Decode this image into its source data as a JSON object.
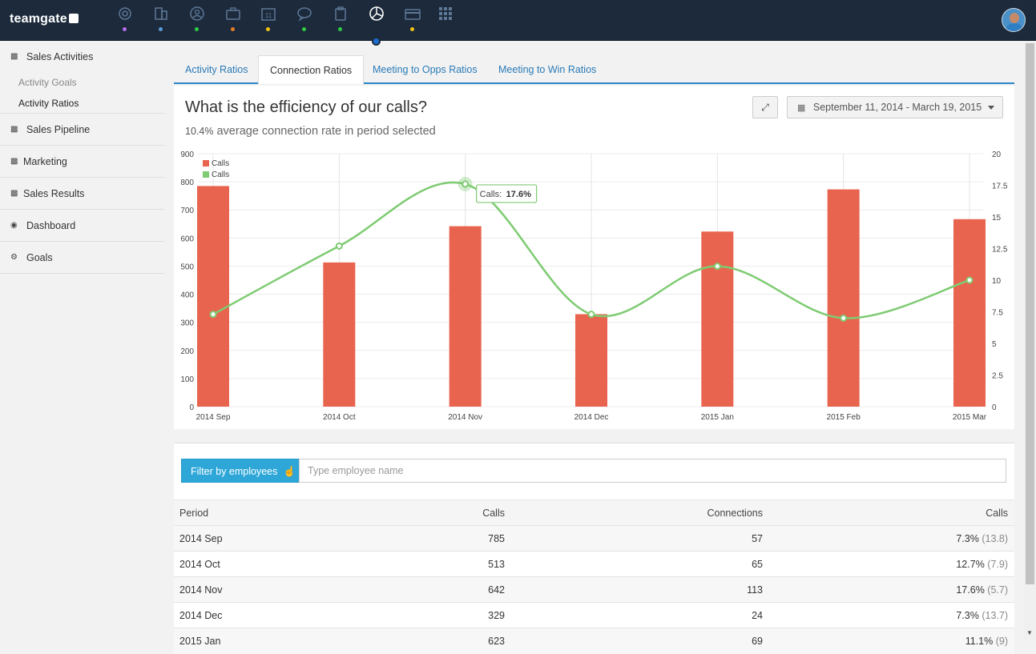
{
  "app": {
    "logo": "teamgate",
    "nav_icons": [
      {
        "name": "target-icon",
        "dot": "#b36ef0"
      },
      {
        "name": "building-icon",
        "dot": "#5b9bd5"
      },
      {
        "name": "person-icon",
        "dot": "#2ecc40"
      },
      {
        "name": "briefcase-icon",
        "dot": "#e67e22"
      },
      {
        "name": "calendar-icon",
        "dot": "#f1c40f",
        "label": "11"
      },
      {
        "name": "chat-icon",
        "dot": "#2ecc40"
      },
      {
        "name": "clipboard-icon",
        "dot": "#2ecc40"
      },
      {
        "name": "pie-chart-icon",
        "dot": null,
        "active": true
      },
      {
        "name": "credit-card-icon",
        "dot": "#f1c40f"
      },
      {
        "name": "grid-icon",
        "dot": null
      }
    ]
  },
  "sidebar": {
    "sections": [
      {
        "label": "Sales Activities",
        "icon": "bar-chart-icon",
        "items": [
          {
            "label": "Activity Goals",
            "active": false
          },
          {
            "label": "Activity Ratios",
            "active": true
          }
        ]
      },
      {
        "label": "Sales Pipeline",
        "icon": "bar-chart-icon"
      },
      {
        "label": "Marketing",
        "icon": "bar-chart-icon"
      },
      {
        "label": "Sales Results",
        "icon": "bar-chart-icon"
      },
      {
        "label": "Dashboard",
        "icon": "dashboard-icon"
      },
      {
        "label": "Goals",
        "icon": "gears-icon"
      }
    ]
  },
  "tabs": [
    {
      "label": "Activity Ratios",
      "active": false
    },
    {
      "label": "Connection Ratios",
      "active": true
    },
    {
      "label": "Meeting to Opps Ratios",
      "active": false
    },
    {
      "label": "Meeting to Win Ratios",
      "active": false
    }
  ],
  "panel": {
    "title": "What is the efficiency of our calls?",
    "subtitle_value": "10.4%",
    "subtitle_text": "average connection rate in period selected",
    "date_range": "September 11, 2014 - March 19, 2015"
  },
  "chart_data": {
    "type": "bar",
    "categories": [
      "2014 Sep",
      "2014 Oct",
      "2014 Nov",
      "2014 Dec",
      "2015 Jan",
      "2015 Feb",
      "2015 Mar"
    ],
    "series": [
      {
        "name": "Calls",
        "type": "bar",
        "axis": "left",
        "color": "#e8644f",
        "values": [
          785,
          513,
          642,
          329,
          623,
          773,
          667
        ]
      },
      {
        "name": "Calls",
        "type": "line",
        "axis": "right",
        "color": "#7ecb72",
        "values": [
          7.3,
          12.7,
          17.6,
          7.3,
          11.1,
          7.0,
          10.0
        ]
      }
    ],
    "y_left": {
      "ylim": [
        0,
        900
      ],
      "ticks": [
        0,
        100,
        200,
        300,
        400,
        500,
        600,
        700,
        800,
        900
      ]
    },
    "y_right": {
      "ylim": [
        0,
        20
      ],
      "ticks": [
        "0",
        "2.5",
        "5",
        "7.5",
        "10",
        "12.5",
        "15",
        "17.5",
        "20"
      ]
    },
    "legend": {
      "placement": "top-left",
      "entries": [
        "Calls",
        "Calls"
      ]
    },
    "tooltip": {
      "label": "Calls:",
      "value": "17.6%",
      "index": 2
    },
    "grid": true
  },
  "filter": {
    "button_label": "Filter by employees",
    "placeholder": "Type employee name"
  },
  "table": {
    "headers": [
      "Period",
      "Calls",
      "Connections",
      "Calls"
    ],
    "rows": [
      {
        "period": "2014 Sep",
        "calls": "785",
        "connections": "57",
        "rate": "7.3%",
        "rate_extra": "(13.8)"
      },
      {
        "period": "2014 Oct",
        "calls": "513",
        "connections": "65",
        "rate": "12.7%",
        "rate_extra": "(7.9)"
      },
      {
        "period": "2014 Nov",
        "calls": "642",
        "connections": "113",
        "rate": "17.6%",
        "rate_extra": "(5.7)"
      },
      {
        "period": "2014 Dec",
        "calls": "329",
        "connections": "24",
        "rate": "7.3%",
        "rate_extra": "(13.7)"
      },
      {
        "period": "2015 Jan",
        "calls": "623",
        "connections": "69",
        "rate": "11.1%",
        "rate_extra": "(9)"
      }
    ]
  }
}
